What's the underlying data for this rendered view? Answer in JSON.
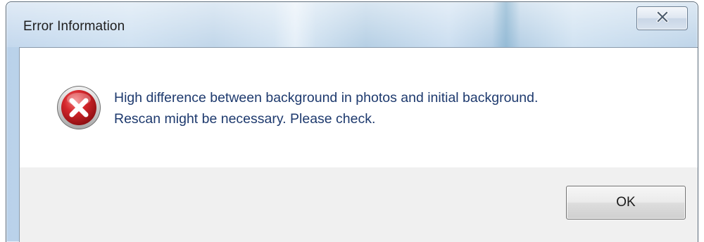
{
  "window": {
    "title": "Error Information",
    "close_button_glyph": "x-icon"
  },
  "dialog": {
    "icon": "error-icon",
    "message_lines": [
      "High difference between background in photos and initial background.",
      "Rescan might be necessary. Please check."
    ]
  },
  "buttons": {
    "ok_label": "OK"
  },
  "colors": {
    "message_text": "#1e3a6e",
    "error_red": "#c8102e",
    "footer_background": "#f0f0f0",
    "frame_glass": "#b9d1ea"
  }
}
